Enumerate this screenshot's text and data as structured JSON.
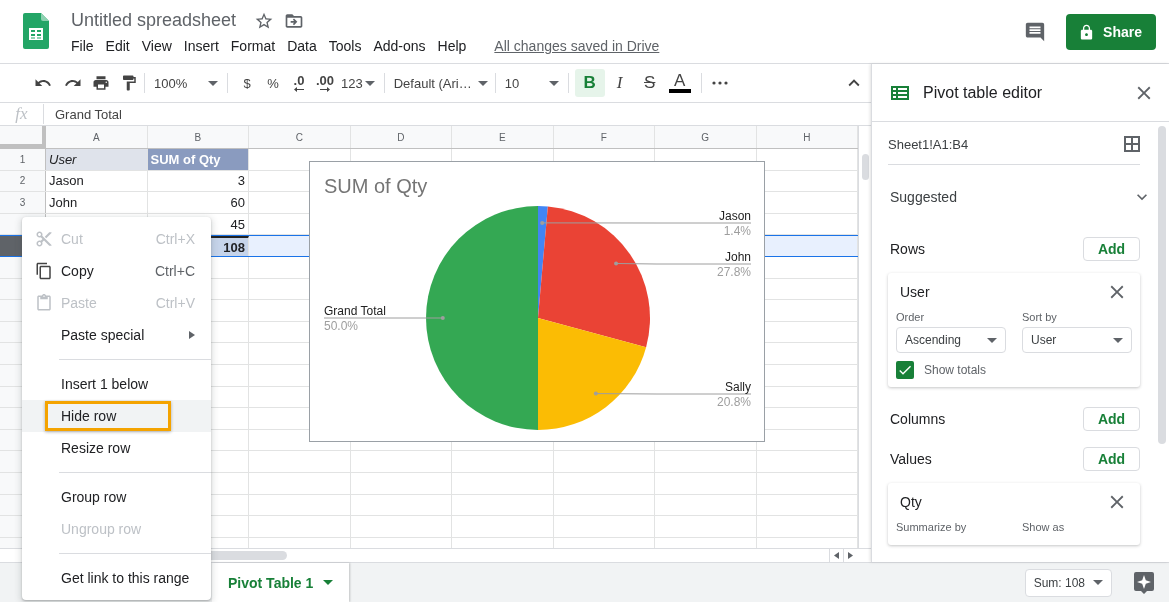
{
  "app": {
    "title": "Untitled spreadsheet",
    "menus": [
      "File",
      "Edit",
      "View",
      "Insert",
      "Format",
      "Data",
      "Tools",
      "Add-ons",
      "Help"
    ],
    "save_status": "All changes saved in Drive",
    "share_button": "Share"
  },
  "toolbar": {
    "zoom": "100%",
    "currency": "$",
    "percent": "%",
    "decrease_decimals": ".0",
    "increase_decimals": ".00",
    "number_format": "123",
    "font": "Default (Ari…",
    "font_size": "10",
    "styles": [
      {
        "kind": "bold",
        "label": "B",
        "selected": true
      },
      {
        "kind": "italic",
        "label": "I",
        "selected": false
      },
      {
        "kind": "strike",
        "label": "S",
        "selected": false
      },
      {
        "kind": "color",
        "label": "A",
        "selected": false
      }
    ]
  },
  "formula_bar": {
    "label": "fx",
    "value": "Grand Total"
  },
  "grid": {
    "columns": [
      "A",
      "B",
      "C",
      "D",
      "E",
      "F",
      "G",
      "H"
    ],
    "rows": [
      {
        "number": "1",
        "kind": "header",
        "user": "User",
        "sum": "SUM of Qty",
        "selected": false
      },
      {
        "number": "2",
        "kind": "data",
        "user": "Jason",
        "sum": "3",
        "selected": false
      },
      {
        "number": "3",
        "kind": "data",
        "user": "John",
        "sum": "60",
        "selected": false
      },
      {
        "kind": "data",
        "sum": "45",
        "selected": false
      },
      {
        "kind": "total",
        "sum": "108",
        "selected": true
      }
    ]
  },
  "chart": {
    "chart_data": {
      "type": "pie",
      "title": "SUM of Qty",
      "categories": [
        "Jason",
        "John",
        "Sally",
        "Grand Total"
      ],
      "values": [
        1.4,
        27.8,
        20.8,
        50.0
      ],
      "value_labels": [
        "1.4%",
        "27.8%",
        "20.8%",
        "50.0%"
      ]
    }
  },
  "context_menu": {
    "items": [
      {
        "kind": "cut",
        "label": "Cut",
        "shortcut": "Ctrl+X",
        "disabled": true,
        "highlighted": false
      },
      {
        "kind": "copy",
        "label": "Copy",
        "shortcut": "Ctrl+C",
        "disabled": false,
        "highlighted": false
      },
      {
        "kind": "paste",
        "label": "Paste",
        "shortcut": "Ctrl+V",
        "disabled": true,
        "highlighted": false
      },
      {
        "kind": "submenu",
        "label": "Paste special",
        "disabled": false,
        "highlighted": false
      },
      {
        "kind": "divider"
      },
      {
        "kind": "plain",
        "label": "Insert 1 below",
        "disabled": false,
        "highlighted": false
      },
      {
        "kind": "plain",
        "label": "Hide row",
        "disabled": false,
        "highlighted": true
      },
      {
        "kind": "plain",
        "label": "Resize row",
        "disabled": false,
        "highlighted": false
      },
      {
        "kind": "divider"
      },
      {
        "kind": "plain",
        "label": "Group row",
        "disabled": false,
        "highlighted": false
      },
      {
        "kind": "plain",
        "label": "Ungroup row",
        "disabled": true,
        "highlighted": false
      },
      {
        "kind": "divider"
      },
      {
        "kind": "plain",
        "label": "Get link to this range",
        "disabled": false,
        "highlighted": false
      }
    ]
  },
  "sheet_tabs": [
    {
      "label": "Pivot Table 1",
      "selected": true
    }
  ],
  "status": {
    "sum": "Sum: 108"
  },
  "pivot_editor": {
    "title": "Pivot table editor",
    "range": "Sheet1!A1:B4",
    "suggested": {
      "label": "Suggested",
      "expanded": false
    },
    "sections": [
      {
        "label": "Rows",
        "add_button": "Add",
        "fields": [
          {
            "name": "User",
            "settings": [
              {
                "label": "Order",
                "value": "Ascending"
              },
              {
                "label": "Sort by",
                "value": "User"
              }
            ],
            "show_totals": {
              "label": "Show totals",
              "checked": true
            }
          }
        ]
      },
      {
        "label": "Columns",
        "add_button": "Add"
      },
      {
        "label": "Values",
        "add_button": "Add",
        "fields": [
          {
            "name": "Qty",
            "settings": [
              {
                "label": "Summarize by"
              },
              {
                "label": "Show as"
              }
            ]
          }
        ]
      }
    ]
  }
}
